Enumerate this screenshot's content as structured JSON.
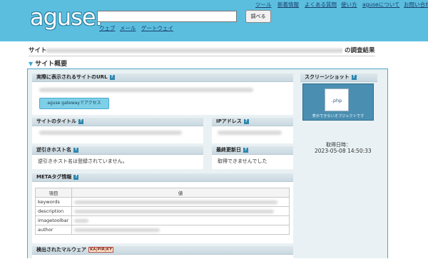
{
  "header": {
    "logo": "aguse.",
    "search_button": "調べる",
    "sub_links": [
      "ウェブ",
      "メール",
      "ゲートウェイ"
    ],
    "top_nav": [
      "ツール",
      "新着情報",
      "よくある質問",
      "使い方",
      "aguseについて",
      "お問い合わせ"
    ]
  },
  "result": {
    "prefix": "サイト",
    "suffix": "の調査結果"
  },
  "section_title": "サイト概要",
  "sections": {
    "displayed_url": "実際に表示されるサイトのURL",
    "gateway_button": "aguse gatewayでアクセス",
    "site_title": "サイトのタイトル",
    "ip_address": "IPアドレス",
    "reverse_host": "逆引きホスト名",
    "reverse_host_value": "逆引きホスト名は登録されていません。",
    "last_modified": "最終更新日",
    "last_modified_value": "取得できませんでした",
    "meta_info": "METAタグ情報",
    "malware": "検出されたマルウェア"
  },
  "screenshot": {
    "title": "スクリーンショット",
    "file_label": ".php",
    "caption": "表示できないオブジェクトです",
    "date_label": "取得日時：",
    "date_value": "2023-05-08 14:50:33"
  },
  "meta_table": {
    "headers": [
      "項目",
      "値"
    ],
    "rows": [
      "keywords",
      "description",
      "imagetoolbar",
      "author"
    ]
  },
  "help_icon": "?",
  "malware_badge": "KA|PIR|KY"
}
